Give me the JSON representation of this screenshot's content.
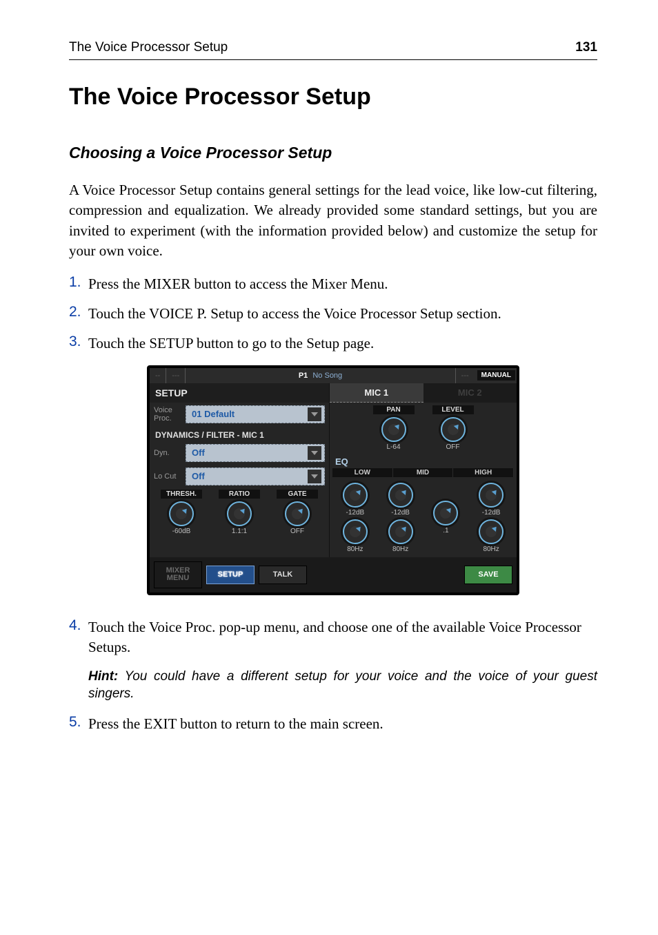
{
  "header": {
    "left": "The Voice Processor Setup",
    "page_number": "131"
  },
  "title": "The Voice Processor Setup",
  "subheading": "Choosing a Voice Processor Setup",
  "intro": "A Voice Processor Setup contains general settings for the lead voice, like low-cut filtering, compression and equalization. We already provided some standard settings, but you are invited to experiment (with the information provided below) and customize the setup for your own voice.",
  "steps": {
    "1": "Press the MIXER button to access the Mixer Menu.",
    "2": "Touch the VOICE P. Setup to access the Voice Processor Setup section.",
    "3": "Touch the SETUP button to go to the Setup page.",
    "4": "Touch the Voice Proc. pop-up menu, and choose one of the available Voice Processor Setups.",
    "5": "Press the EXIT button to return to the main screen."
  },
  "hint": {
    "label": "Hint:",
    "text": " You could have a different setup for your voice and the voice of your guest singers."
  },
  "device": {
    "titlebar": {
      "slot1": "--",
      "slot2": "---",
      "song_prefix": "P1",
      "song_text": "No Song",
      "right_dash": "---",
      "manual": "MANUAL"
    },
    "leftcol": {
      "setup_head": "SETUP",
      "voice_proc_label": "Voice Proc.",
      "voice_proc_value": "01 Default",
      "dyn_section": "DYNAMICS / FILTER - MIC 1",
      "dyn_label": "Dyn.",
      "dyn_value": "Off",
      "locut_label": "Lo Cut",
      "locut_value": "Off",
      "knobs": {
        "thresh": {
          "head": "THRESH.",
          "val": "-60dB"
        },
        "ratio": {
          "head": "RATIO",
          "val": "1.1:1"
        },
        "gate": {
          "head": "GATE",
          "val": "OFF"
        }
      }
    },
    "rightcol": {
      "mic1": "MIC 1",
      "mic2": "MIC 2",
      "pan": {
        "head": "PAN",
        "val": "L-64"
      },
      "level": {
        "head": "LEVEL",
        "val": "OFF"
      },
      "eq_label": "EQ",
      "eq_tabs": {
        "low": "LOW",
        "mid": "MID",
        "high": "HIGH"
      },
      "eq": {
        "low_gain": "-12dB",
        "mid_gain": "-12dB",
        "mid_q": ".1",
        "high_gain": "-12dB",
        "low_freq": "80Hz",
        "mid_freq": "80Hz",
        "high_freq": "80Hz"
      }
    },
    "bottom": {
      "mixer": "MIXER MENU",
      "setup": "SETUP",
      "talk": "TALK",
      "save": "SAVE"
    }
  }
}
